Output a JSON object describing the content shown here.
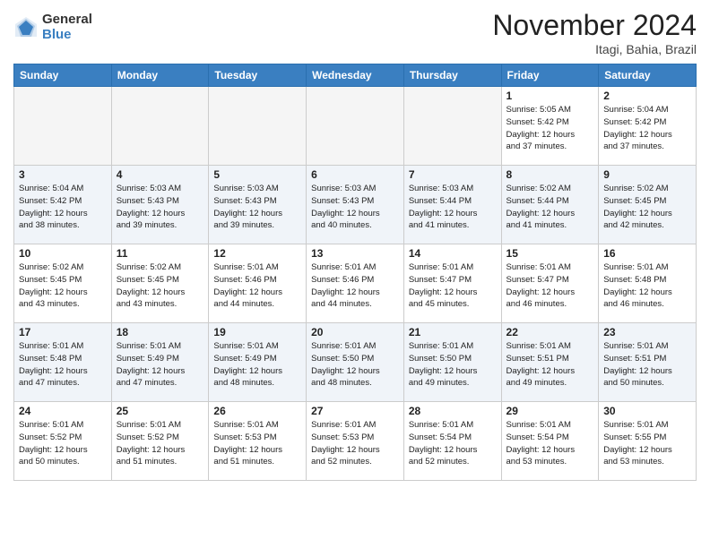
{
  "header": {
    "logo_general": "General",
    "logo_blue": "Blue",
    "month_title": "November 2024",
    "location": "Itagi, Bahia, Brazil"
  },
  "weekdays": [
    "Sunday",
    "Monday",
    "Tuesday",
    "Wednesday",
    "Thursday",
    "Friday",
    "Saturday"
  ],
  "weeks": [
    [
      {
        "day": "",
        "info": ""
      },
      {
        "day": "",
        "info": ""
      },
      {
        "day": "",
        "info": ""
      },
      {
        "day": "",
        "info": ""
      },
      {
        "day": "",
        "info": ""
      },
      {
        "day": "1",
        "info": "Sunrise: 5:05 AM\nSunset: 5:42 PM\nDaylight: 12 hours\nand 37 minutes."
      },
      {
        "day": "2",
        "info": "Sunrise: 5:04 AM\nSunset: 5:42 PM\nDaylight: 12 hours\nand 37 minutes."
      }
    ],
    [
      {
        "day": "3",
        "info": "Sunrise: 5:04 AM\nSunset: 5:42 PM\nDaylight: 12 hours\nand 38 minutes."
      },
      {
        "day": "4",
        "info": "Sunrise: 5:03 AM\nSunset: 5:43 PM\nDaylight: 12 hours\nand 39 minutes."
      },
      {
        "day": "5",
        "info": "Sunrise: 5:03 AM\nSunset: 5:43 PM\nDaylight: 12 hours\nand 39 minutes."
      },
      {
        "day": "6",
        "info": "Sunrise: 5:03 AM\nSunset: 5:43 PM\nDaylight: 12 hours\nand 40 minutes."
      },
      {
        "day": "7",
        "info": "Sunrise: 5:03 AM\nSunset: 5:44 PM\nDaylight: 12 hours\nand 41 minutes."
      },
      {
        "day": "8",
        "info": "Sunrise: 5:02 AM\nSunset: 5:44 PM\nDaylight: 12 hours\nand 41 minutes."
      },
      {
        "day": "9",
        "info": "Sunrise: 5:02 AM\nSunset: 5:45 PM\nDaylight: 12 hours\nand 42 minutes."
      }
    ],
    [
      {
        "day": "10",
        "info": "Sunrise: 5:02 AM\nSunset: 5:45 PM\nDaylight: 12 hours\nand 43 minutes."
      },
      {
        "day": "11",
        "info": "Sunrise: 5:02 AM\nSunset: 5:45 PM\nDaylight: 12 hours\nand 43 minutes."
      },
      {
        "day": "12",
        "info": "Sunrise: 5:01 AM\nSunset: 5:46 PM\nDaylight: 12 hours\nand 44 minutes."
      },
      {
        "day": "13",
        "info": "Sunrise: 5:01 AM\nSunset: 5:46 PM\nDaylight: 12 hours\nand 44 minutes."
      },
      {
        "day": "14",
        "info": "Sunrise: 5:01 AM\nSunset: 5:47 PM\nDaylight: 12 hours\nand 45 minutes."
      },
      {
        "day": "15",
        "info": "Sunrise: 5:01 AM\nSunset: 5:47 PM\nDaylight: 12 hours\nand 46 minutes."
      },
      {
        "day": "16",
        "info": "Sunrise: 5:01 AM\nSunset: 5:48 PM\nDaylight: 12 hours\nand 46 minutes."
      }
    ],
    [
      {
        "day": "17",
        "info": "Sunrise: 5:01 AM\nSunset: 5:48 PM\nDaylight: 12 hours\nand 47 minutes."
      },
      {
        "day": "18",
        "info": "Sunrise: 5:01 AM\nSunset: 5:49 PM\nDaylight: 12 hours\nand 47 minutes."
      },
      {
        "day": "19",
        "info": "Sunrise: 5:01 AM\nSunset: 5:49 PM\nDaylight: 12 hours\nand 48 minutes."
      },
      {
        "day": "20",
        "info": "Sunrise: 5:01 AM\nSunset: 5:50 PM\nDaylight: 12 hours\nand 48 minutes."
      },
      {
        "day": "21",
        "info": "Sunrise: 5:01 AM\nSunset: 5:50 PM\nDaylight: 12 hours\nand 49 minutes."
      },
      {
        "day": "22",
        "info": "Sunrise: 5:01 AM\nSunset: 5:51 PM\nDaylight: 12 hours\nand 49 minutes."
      },
      {
        "day": "23",
        "info": "Sunrise: 5:01 AM\nSunset: 5:51 PM\nDaylight: 12 hours\nand 50 minutes."
      }
    ],
    [
      {
        "day": "24",
        "info": "Sunrise: 5:01 AM\nSunset: 5:52 PM\nDaylight: 12 hours\nand 50 minutes."
      },
      {
        "day": "25",
        "info": "Sunrise: 5:01 AM\nSunset: 5:52 PM\nDaylight: 12 hours\nand 51 minutes."
      },
      {
        "day": "26",
        "info": "Sunrise: 5:01 AM\nSunset: 5:53 PM\nDaylight: 12 hours\nand 51 minutes."
      },
      {
        "day": "27",
        "info": "Sunrise: 5:01 AM\nSunset: 5:53 PM\nDaylight: 12 hours\nand 52 minutes."
      },
      {
        "day": "28",
        "info": "Sunrise: 5:01 AM\nSunset: 5:54 PM\nDaylight: 12 hours\nand 52 minutes."
      },
      {
        "day": "29",
        "info": "Sunrise: 5:01 AM\nSunset: 5:54 PM\nDaylight: 12 hours\nand 53 minutes."
      },
      {
        "day": "30",
        "info": "Sunrise: 5:01 AM\nSunset: 5:55 PM\nDaylight: 12 hours\nand 53 minutes."
      }
    ]
  ]
}
